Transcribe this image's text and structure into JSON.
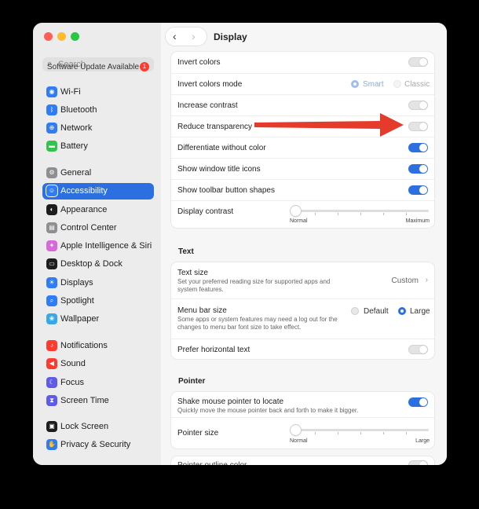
{
  "colors": {
    "accent": "#2b6fe0",
    "arrow": "#e53b2c"
  },
  "sidebar": {
    "search_placeholder": "Search",
    "update_text": "Software Update Available",
    "update_badge": "1",
    "items": [
      {
        "label": "Wi-Fi",
        "icon": "wifi-icon",
        "color": "#2f7cf6"
      },
      {
        "label": "Bluetooth",
        "icon": "bluetooth-icon",
        "color": "#2f7cf6"
      },
      {
        "label": "Network",
        "icon": "globe-icon",
        "color": "#2f7cf6"
      },
      {
        "label": "Battery",
        "icon": "battery-icon",
        "color": "#33c24d"
      },
      {
        "label": "General",
        "icon": "gear-icon",
        "color": "#8e8e93"
      },
      {
        "label": "Accessibility",
        "icon": "accessibility-icon",
        "color": "#2f7cf6"
      },
      {
        "label": "Appearance",
        "icon": "appearance-icon",
        "color": "#1d1d1f"
      },
      {
        "label": "Control Center",
        "icon": "control-center-icon",
        "color": "#8e8e93"
      },
      {
        "label": "Apple Intelligence & Siri",
        "icon": "siri-icon",
        "color": "#d66bd8"
      },
      {
        "label": "Desktop & Dock",
        "icon": "dock-icon",
        "color": "#1d1d1f"
      },
      {
        "label": "Displays",
        "icon": "sun-icon",
        "color": "#2f7cf6"
      },
      {
        "label": "Spotlight",
        "icon": "magnifier-icon",
        "color": "#2f7cf6"
      },
      {
        "label": "Wallpaper",
        "icon": "flower-icon",
        "color": "#37a9e8"
      },
      {
        "label": "Notifications",
        "icon": "bell-icon",
        "color": "#ff3b30"
      },
      {
        "label": "Sound",
        "icon": "speaker-icon",
        "color": "#ff3b30"
      },
      {
        "label": "Focus",
        "icon": "moon-icon",
        "color": "#5e5ce6"
      },
      {
        "label": "Screen Time",
        "icon": "hourglass-icon",
        "color": "#5e5ce6"
      },
      {
        "label": "Lock Screen",
        "icon": "lock-icon",
        "color": "#1d1d1f"
      },
      {
        "label": "Privacy & Security",
        "icon": "hand-icon",
        "color": "#2f7cf6"
      }
    ]
  },
  "toolbar": {
    "back": "‹",
    "forward": "›",
    "title": "Display"
  },
  "display": {
    "invert_colors": "Invert colors",
    "invert_mode": "Invert colors mode",
    "smart": "Smart",
    "classic": "Classic",
    "increase_contrast": "Increase contrast",
    "reduce_transparency": "Reduce transparency",
    "differentiate": "Differentiate without color",
    "window_title_icons": "Show window title icons",
    "toolbar_shapes": "Show toolbar button shapes",
    "display_contrast": "Display contrast",
    "contrast_min": "Normal",
    "contrast_max": "Maximum"
  },
  "text_section": {
    "heading": "Text",
    "text_size": "Text size",
    "text_size_desc": "Set your preferred reading size for supported apps and system features.",
    "text_size_value": "Custom",
    "menu_bar_size": "Menu bar size",
    "menu_bar_desc": "Some apps or system features may need a log out for the changes to menu bar font size to take effect.",
    "default": "Default",
    "large": "Large",
    "prefer_horizontal": "Prefer horizontal text"
  },
  "pointer_section": {
    "heading": "Pointer",
    "shake": "Shake mouse pointer to locate",
    "shake_desc": "Quickly move the mouse pointer back and forth to make it bigger.",
    "pointer_size": "Pointer size",
    "size_min": "Normal",
    "size_max": "Large",
    "outline_color": "Pointer outline color"
  }
}
